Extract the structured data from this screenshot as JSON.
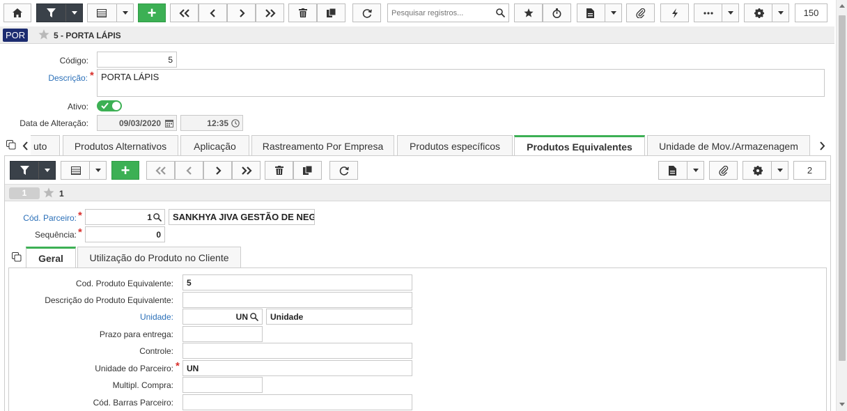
{
  "toolbar": {
    "search_placeholder": "Pesquisar registros...",
    "page_size": "150"
  },
  "header": {
    "badge": "POR",
    "title": "5 - PORTA LÁPIS"
  },
  "form": {
    "codigo_label": "Código:",
    "codigo_value": "5",
    "descricao_label": "Descrição:",
    "descricao_value": "PORTA LÁPIS",
    "ativo_label": "Ativo:",
    "data_label": "Data de Alteração:",
    "data_value": "09/03/2020",
    "hora_value": "12:35"
  },
  "tabs": [
    "uto",
    "Produtos Alternativos",
    "Aplicação",
    "Rastreamento Por Empresa",
    "Produtos específicos",
    "Produtos Equivalentes",
    "Unidade de Mov./Armazenagem"
  ],
  "subtoolbar": {
    "page_size": "2"
  },
  "record": {
    "badge": "1",
    "title": "1"
  },
  "detail": {
    "cod_parceiro_label": "Cód. Parceiro:",
    "cod_parceiro_value": "1",
    "parceiro_nome": "SANKHYA JIVA GESTÃO DE NEG",
    "sequencia_label": "Sequência:",
    "sequencia_value": "0"
  },
  "subtabs": [
    "Geral",
    "Utilização do Produto no Cliente"
  ],
  "geral": {
    "cod_prod_equiv_label": "Cod. Produto Equivalente:",
    "cod_prod_equiv_value": "5",
    "desc_prod_equiv_label": "Descrição do Produto Equivalente:",
    "desc_prod_equiv_value": "",
    "unidade_label": "Unidade:",
    "unidade_code": "UN",
    "unidade_desc": "Unidade",
    "prazo_label": "Prazo para entrega:",
    "controle_label": "Controle:",
    "unid_parceiro_label": "Unidade do Parceiro:",
    "unid_parceiro_value": "UN",
    "multipl_label": "Multipl. Compra:",
    "cod_barras_label": "Cód. Barras Parceiro:"
  },
  "colors": {
    "accent_green": "#3cb054",
    "dark_button": "#3a4149",
    "link_blue": "#2a6fb8",
    "badge_navy": "#1c2c70"
  }
}
